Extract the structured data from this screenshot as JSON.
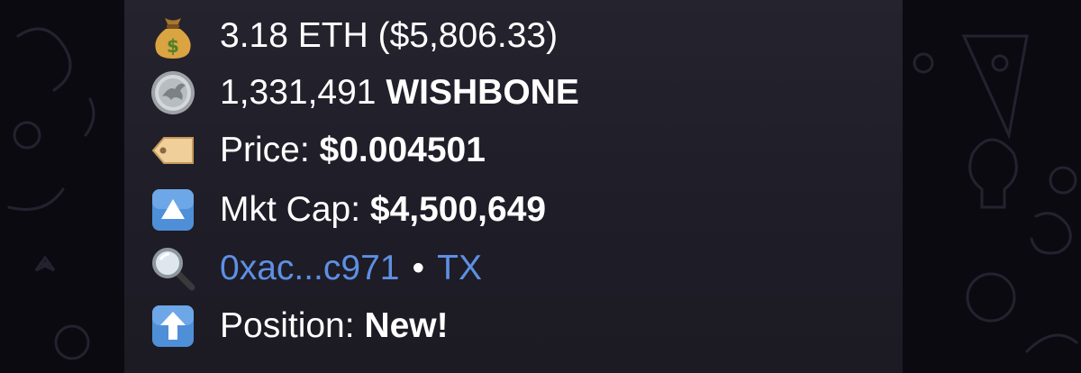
{
  "message": {
    "eth_line": {
      "amount": "3.18 ETH",
      "usd": "($5,806.33)"
    },
    "token_line": {
      "amount": "1,331,491",
      "symbol": "WISHBONE"
    },
    "price_line": {
      "label": "Price:",
      "value": "$0.004501"
    },
    "mktcap_line": {
      "label": "Mkt Cap:",
      "value": "$4,500,649"
    },
    "tx_line": {
      "address": "0xac...c971",
      "separator": "•",
      "tx_label": "TX"
    },
    "position_line": {
      "label": "Position:",
      "value": "New!"
    }
  },
  "icons": {
    "eth_line": "money-bag-icon",
    "token_line": "coin-icon",
    "price_line": "price-tag-icon",
    "mktcap_line": "up-triangle-button-icon",
    "tx_line": "magnifying-glass-icon",
    "position_line": "up-arrow-button-icon"
  },
  "colors": {
    "link": "#5e8fe3",
    "text": "#ffffff",
    "bubble": "#25232d",
    "background": "#0b0a10"
  }
}
